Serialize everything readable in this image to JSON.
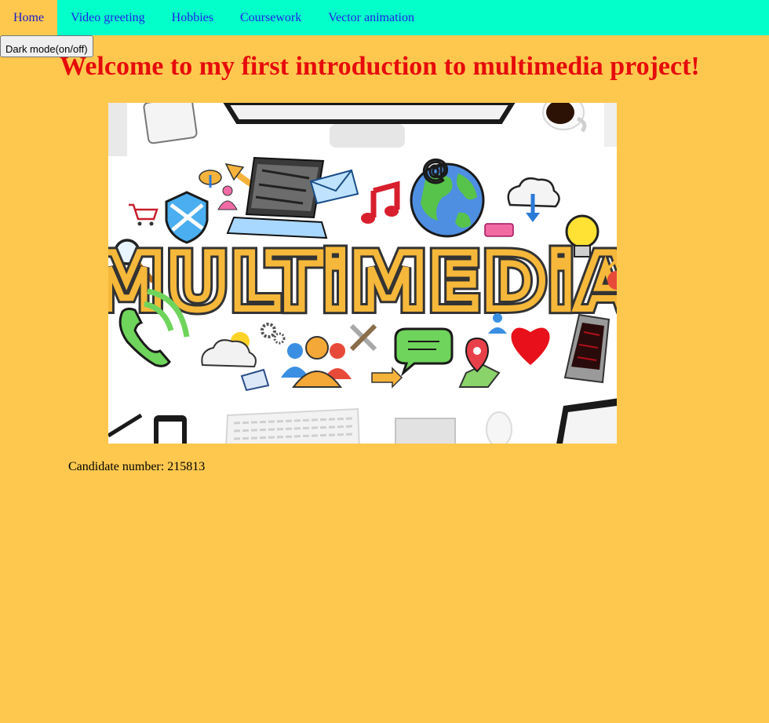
{
  "nav": {
    "items": [
      {
        "label": "Home",
        "active": true
      },
      {
        "label": "Video greeting",
        "active": false
      },
      {
        "label": "Hobbies",
        "active": false
      },
      {
        "label": "Coursework",
        "active": false
      },
      {
        "label": "Vector animation",
        "active": false
      }
    ]
  },
  "dark_mode_button": {
    "label": "Dark mode(on/off)"
  },
  "main": {
    "title": "Welcome to my first introduction to multimedia project!",
    "hero_image": {
      "text": "MULTiMEDiA",
      "icons": [
        "monitor-icon",
        "coffee-cup-icon",
        "phone-icon",
        "laptop-icon",
        "envelope-icon",
        "music-note-icon",
        "globe-icon",
        "cloud-download-icon",
        "lightbulb-icon",
        "shield-icon",
        "shopping-cart-icon",
        "magnifier-icon",
        "telephone-icon",
        "sun-cloud-icon",
        "gears-icon",
        "users-icon",
        "tools-icon",
        "chat-bubble-icon",
        "map-pin-icon",
        "heart-icon",
        "smartphone-icon",
        "keyboard-icon",
        "mouse-icon",
        "tablet-icon"
      ]
    },
    "candidate": "Candidate number: 215813"
  },
  "colors": {
    "page_background": "#fec84f",
    "navbar_background": "#03ffca",
    "nav_link": "#1f1fe6",
    "title": "#e60b0b",
    "hero_lettering": "#f6b83a"
  }
}
